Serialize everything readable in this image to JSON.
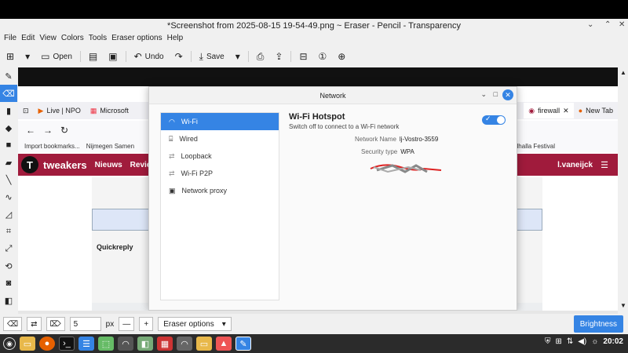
{
  "window": {
    "title": "*Screenshot from 2025-08-15 19-54-49.png ~ Eraser - Pencil - Transparency",
    "controls": [
      "⌄",
      "⌃",
      "✕"
    ]
  },
  "menubar": {
    "items": [
      "File",
      "Edit",
      "View",
      "Colors",
      "Tools",
      "Eraser options",
      "Help"
    ]
  },
  "toolbar": {
    "open_label": "Open",
    "undo_label": "Undo",
    "save_label": "Save"
  },
  "bottom": {
    "size_value": "5",
    "size_unit": "px",
    "minus": "—",
    "plus": "+",
    "eraser_options_label": "Eraser options",
    "brightness_label": "Brightness"
  },
  "browser": {
    "tabs": [
      "Live | NPO",
      "Microsoft",
      "firewall",
      "New Tab"
    ],
    "bookmarks": [
      "Import bookmarks...",
      "Nijmegen Samen",
      "alhalla Festival"
    ],
    "site": {
      "logo_letter": "T",
      "name": "tweakers",
      "nav": [
        "Nieuws",
        "Reviews"
      ],
      "user": "l.vaneijck",
      "quickreply": "Quickreply"
    }
  },
  "dialog": {
    "title": "Network",
    "sidebar": [
      {
        "label": "Wi-Fi",
        "icon": "wifi-icon",
        "active": true
      },
      {
        "label": "Wired",
        "icon": "wired-icon",
        "active": false
      },
      {
        "label": "Loopback",
        "icon": "loopback-icon",
        "active": false
      },
      {
        "label": "Wi-Fi P2P",
        "icon": "p2p-icon",
        "active": false
      },
      {
        "label": "Network proxy",
        "icon": "proxy-icon",
        "active": false
      }
    ],
    "hotspot": {
      "title": "Wi-Fi Hotspot",
      "subtitle": "Switch off to connect to a Wi-Fi network",
      "enabled": true,
      "network_name_label": "Network Name",
      "network_name_value": "lj-Vostro-3559",
      "security_label": "Security type",
      "security_value": "WPA"
    }
  },
  "taskbar": {
    "clock": "20:02"
  },
  "colors": {
    "accent": "#3584e4",
    "tweakers_red": "#a01b3c",
    "taskbar": "#2b2b2b"
  }
}
